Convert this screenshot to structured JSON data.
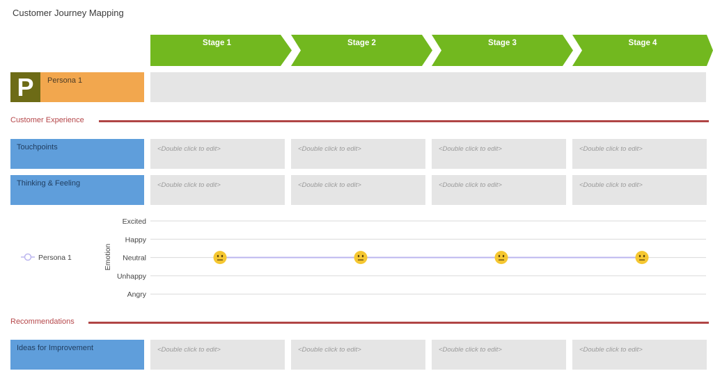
{
  "title": "Customer Journey Mapping",
  "stages": [
    {
      "label": "Stage 1"
    },
    {
      "label": "Stage 2"
    },
    {
      "label": "Stage 3"
    },
    {
      "label": "Stage 4"
    }
  ],
  "colors": {
    "stage": "#72b81f",
    "persona_box": "#f2a74e",
    "persona_avatar": "#6d6b16",
    "lane_label": "#5f9edb",
    "cell": "#e5e5e5",
    "section": "#b04545",
    "emotion_line": "#bcb6ef",
    "emoji": "#f5c731"
  },
  "persona": {
    "avatar_letter": "P",
    "name": "Persona 1"
  },
  "sections": {
    "customer_experience": "Customer Experience",
    "recommendations": "Recommendations"
  },
  "rows": {
    "touchpoints": {
      "label": "Touchpoints",
      "cells": [
        "<Double click to edit>",
        "<Double click to edit>",
        "<Double click to edit>",
        "<Double click to edit>"
      ]
    },
    "thinking_feeling": {
      "label": "Thinking & Feeling",
      "cells": [
        "<Double click to edit>",
        "<Double click to edit>",
        "<Double click to edit>",
        "<Double click to edit>"
      ]
    },
    "ideas": {
      "label": "Ideas for Improvement",
      "cells": [
        "<Double click to edit>",
        "<Double click to edit>",
        "<Double click to edit>",
        "<Double click to edit>"
      ]
    }
  },
  "chart_data": {
    "type": "line",
    "title": "",
    "ylabel": "Emotion",
    "xlabel": "",
    "categories": [
      "Stage 1",
      "Stage 2",
      "Stage 3",
      "Stage 4"
    ],
    "y_levels": [
      "Excited",
      "Happy",
      "Neutral",
      "Unhappy",
      "Angry"
    ],
    "series": [
      {
        "name": "Persona 1",
        "values": [
          "Neutral",
          "Neutral",
          "Neutral",
          "Neutral"
        ],
        "marker": "neutral-face-emoji"
      }
    ],
    "legend": "left",
    "grid": true
  }
}
